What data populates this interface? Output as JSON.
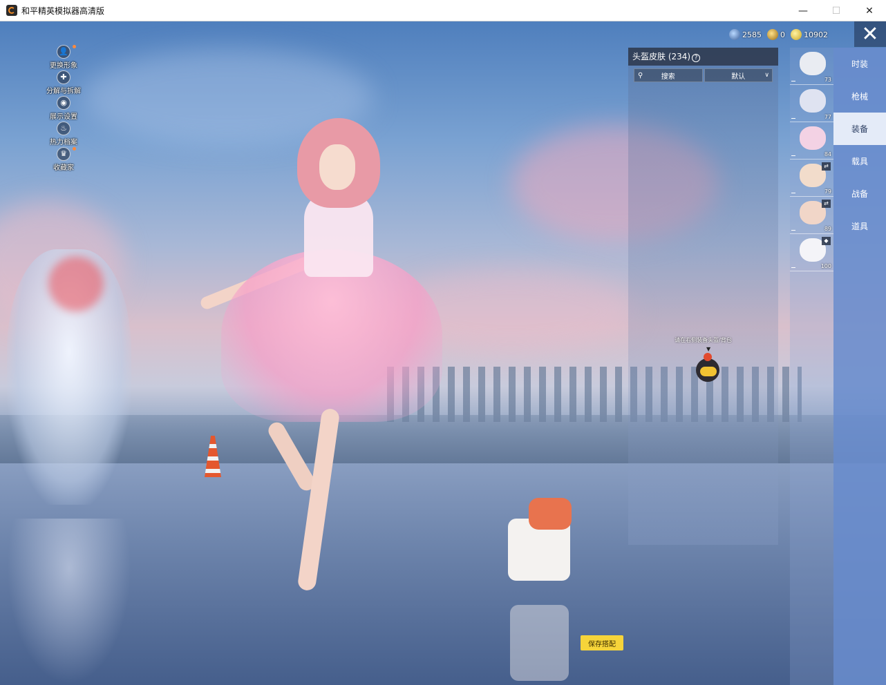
{
  "window": {
    "title": "和平精英模拟器高清版",
    "minimize": "—",
    "maximize": "☐",
    "close": "✕"
  },
  "side_menu": [
    {
      "label": "更换形象",
      "icon": "person-icon",
      "glyph": "👤"
    },
    {
      "label": "分解与拆解",
      "icon": "puzzle-icon",
      "glyph": "✚"
    },
    {
      "label": "展示设置",
      "icon": "eye-icon",
      "glyph": "◉"
    },
    {
      "label": "热力档案",
      "icon": "flame-icon",
      "glyph": "♨"
    },
    {
      "label": "收藏家",
      "icon": "crown-icon",
      "glyph": "♛"
    }
  ],
  "currency": [
    {
      "icon": "diamond-icon",
      "value": "2585"
    },
    {
      "icon": "token-icon",
      "value": "0"
    },
    {
      "icon": "coin-icon",
      "value": "10902"
    }
  ],
  "close_glyph": "✕",
  "list_panel": {
    "title": "头盔皮肤 (234)",
    "help_glyph": "?",
    "search_label": "搜索",
    "sort_label": "默认",
    "hint": "请在右侧装备头盔/背包"
  },
  "thumbs": [
    {
      "num": "73",
      "color": "#e9ecf2",
      "tag": ""
    },
    {
      "num": "77",
      "color": "#dfe3f1",
      "tag": ""
    },
    {
      "num": "84",
      "color": "#f3d2e4",
      "tag": ""
    },
    {
      "num": "79",
      "color": "#f2dccb",
      "tag": "⇄"
    },
    {
      "num": "89",
      "color": "#f1d6c8",
      "tag": "⇄"
    },
    {
      "num": "100",
      "color": "#f4f4f8",
      "tag": "◆"
    }
  ],
  "categories": [
    {
      "label": "时装",
      "active": false
    },
    {
      "label": "枪械",
      "active": false
    },
    {
      "label": "装备",
      "active": true
    },
    {
      "label": "载具",
      "active": false
    },
    {
      "label": "战备",
      "active": false
    },
    {
      "label": "道具",
      "active": false
    }
  ],
  "save_button": "保存搭配"
}
